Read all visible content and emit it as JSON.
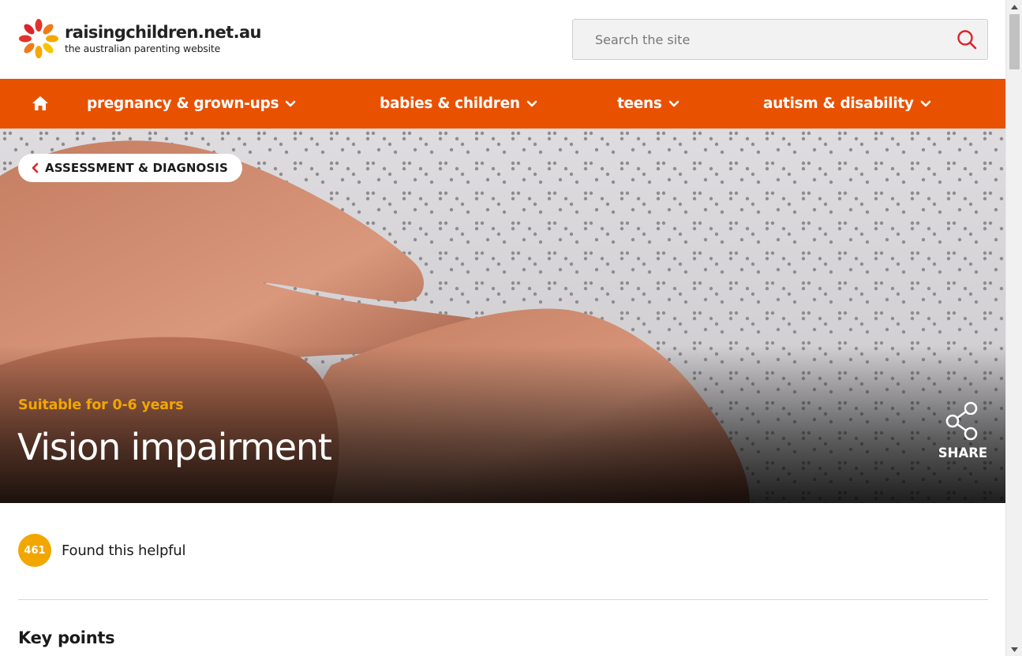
{
  "header": {
    "logo_name": "raisingchildren.net.au",
    "logo_tagline": "the australian parenting website",
    "search_placeholder": "Search the site"
  },
  "nav": {
    "items": [
      {
        "label": "pregnancy & grown-ups"
      },
      {
        "label": "babies & children"
      },
      {
        "label": "teens"
      },
      {
        "label": "autism & disability"
      }
    ]
  },
  "hero": {
    "breadcrumb": "ASSESSMENT & DIAGNOSIS",
    "suitable": "Suitable for 0-6 years",
    "title": "Vision impairment",
    "share_label": "SHARE"
  },
  "helpful": {
    "count": "461",
    "label": "Found this helpful"
  },
  "content": {
    "section_heading": "Key points"
  },
  "colors": {
    "nav_orange": "#e85100",
    "accent_yellow": "#f2a600",
    "search_icon_red": "#d9262b"
  }
}
